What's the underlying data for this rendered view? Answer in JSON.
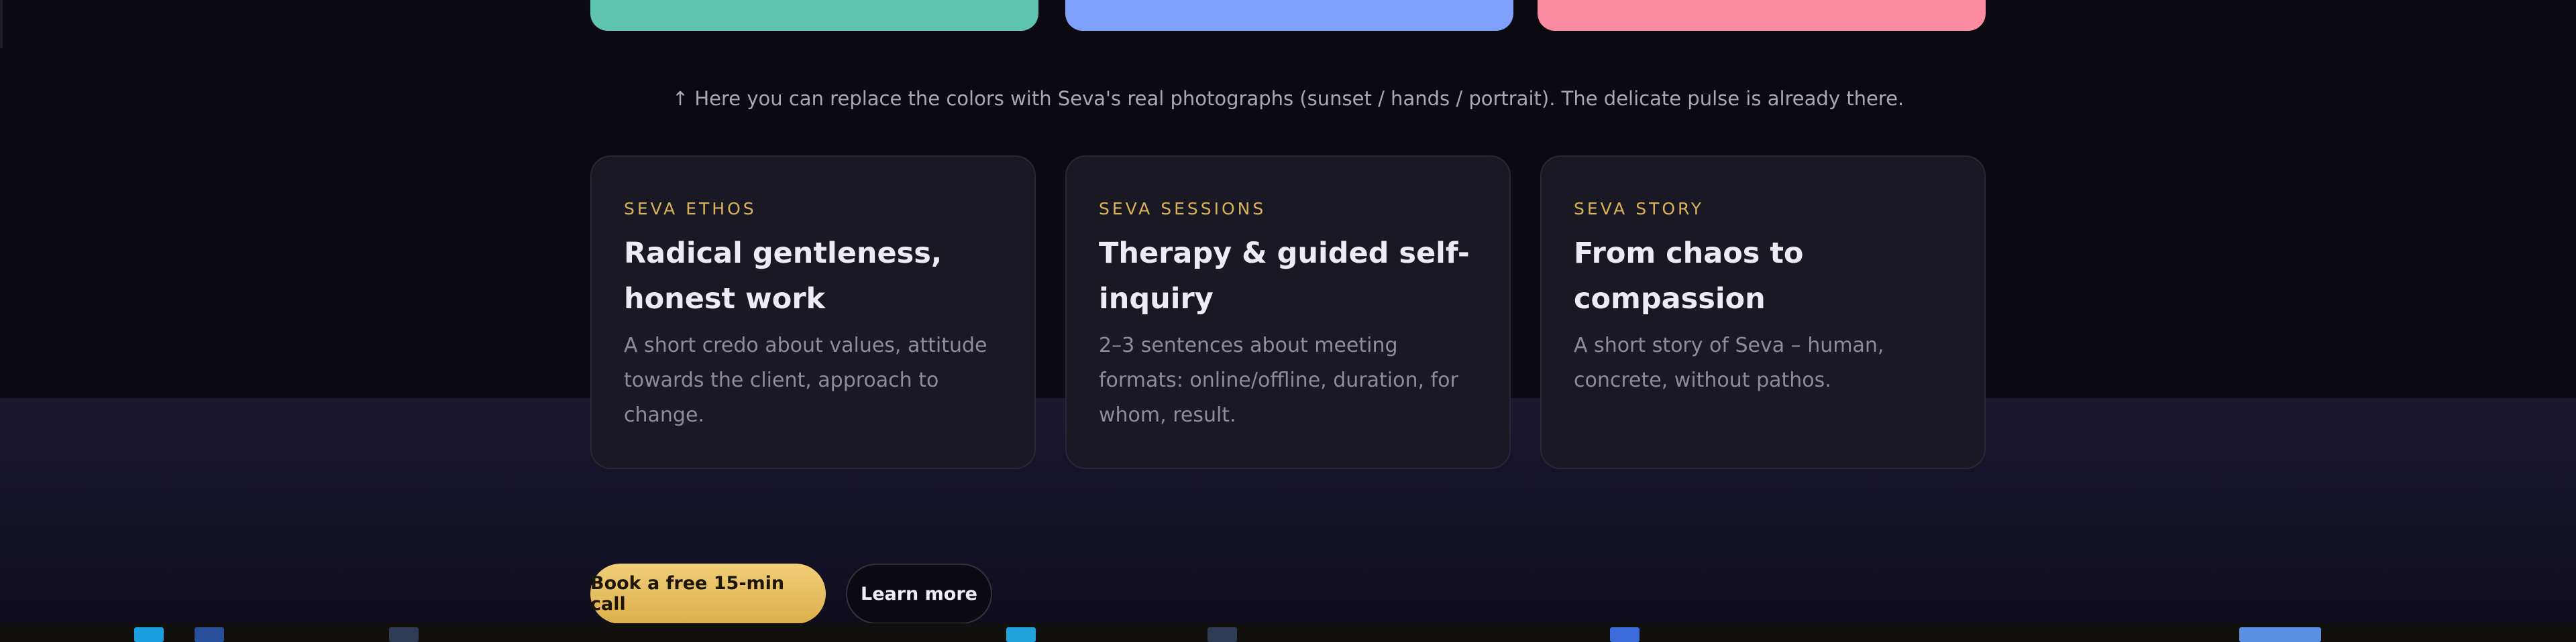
{
  "photo_placeholders": [
    {
      "name": "sunset",
      "color": "#5ec4ad"
    },
    {
      "name": "hands",
      "color": "#7fa0fb"
    },
    {
      "name": "portrait",
      "color": "#fb8ba0"
    }
  ],
  "note": "↑ Here you can replace the colors with Seva's real photographs (sunset / hands / portrait). The delicate pulse is already there.",
  "cards": [
    {
      "kicker": "SEVA ETHOS",
      "title": "Radical gentleness, honest work",
      "body": "A short credo about values, attitude towards the client, approach to change."
    },
    {
      "kicker": "SEVA SESSIONS",
      "title": "Therapy & guided self-inquiry",
      "body": "2–3 sentences about meeting formats: online/offline, duration, for whom, result."
    },
    {
      "kicker": "SEVA STORY",
      "title": "From chaos to compassion",
      "body": "A short story of Seva – human, concrete, without pathos."
    }
  ],
  "cta": {
    "primary": "Book a free 15-min call",
    "secondary": "Learn more"
  },
  "colors": {
    "accent": "#d8b25a",
    "background": "#0b0a10",
    "card": "#1a1822"
  }
}
